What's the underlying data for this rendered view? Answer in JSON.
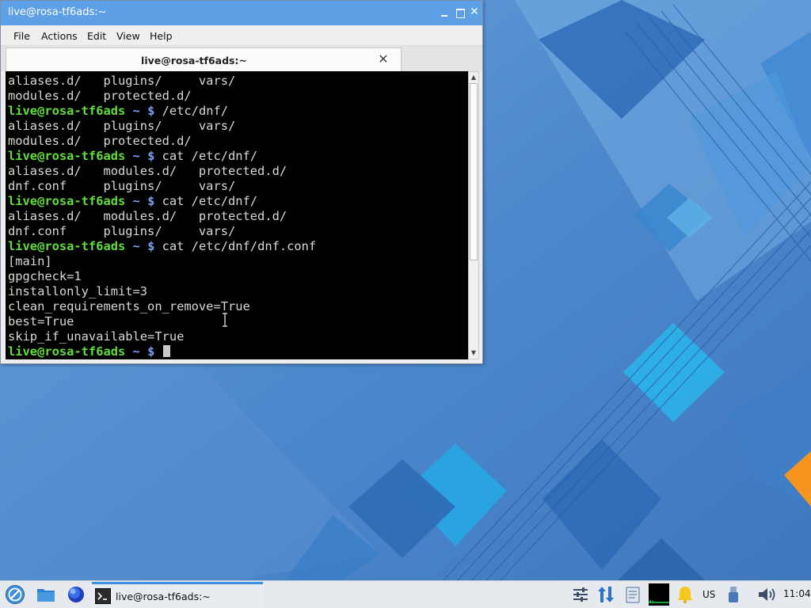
{
  "window": {
    "title": "live@rosa-tf6ads:~",
    "controls": {
      "minimize": "minimize",
      "maximize": "maximize",
      "close": "✕"
    }
  },
  "menubar": {
    "items": [
      "File",
      "Actions",
      "Edit",
      "View",
      "Help"
    ]
  },
  "tab": {
    "label": "live@rosa-tf6ads:~",
    "close": "✕"
  },
  "terminal": {
    "prompt_user": "live@rosa-tf6ads",
    "prompt_symbol": " ~ $ ",
    "lines": [
      {
        "type": "out",
        "text": "aliases.d/   plugins/     vars/"
      },
      {
        "type": "out",
        "text": "modules.d/   protected.d/"
      },
      {
        "type": "prompt",
        "cmd": "/etc/dnf/"
      },
      {
        "type": "out",
        "text": "aliases.d/   plugins/     vars/"
      },
      {
        "type": "out",
        "text": "modules.d/   protected.d/"
      },
      {
        "type": "prompt",
        "cmd": "cat /etc/dnf/"
      },
      {
        "type": "out",
        "text": "aliases.d/   modules.d/   protected.d/"
      },
      {
        "type": "out",
        "text": "dnf.conf     plugins/     vars/"
      },
      {
        "type": "prompt",
        "cmd": "cat /etc/dnf/"
      },
      {
        "type": "out",
        "text": "aliases.d/   modules.d/   protected.d/"
      },
      {
        "type": "out",
        "text": "dnf.conf     plugins/     vars/"
      },
      {
        "type": "prompt",
        "cmd": "cat /etc/dnf/dnf.conf"
      },
      {
        "type": "out",
        "text": "[main]"
      },
      {
        "type": "out",
        "text": "gpgcheck=1"
      },
      {
        "type": "out",
        "text": "installonly_limit=3"
      },
      {
        "type": "out",
        "text": "clean_requirements_on_remove=True"
      },
      {
        "type": "out",
        "text": "best=True"
      },
      {
        "type": "out",
        "text": "skip_if_unavailable=True"
      },
      {
        "type": "prompt",
        "cmd": "",
        "cursor": true
      }
    ]
  },
  "taskbar": {
    "task_label": "live@rosa-tf6ads:~",
    "keyboard_layout": "US",
    "clock": "11:04",
    "icons": [
      "rosa-menu-icon",
      "file-manager-icon",
      "browser-icon",
      "terminal-icon",
      "mixer-icon",
      "network-icon",
      "clipboard-icon",
      "system-monitor-icon",
      "notifications-icon",
      "usb-icon",
      "volume-icon"
    ]
  },
  "colors": {
    "titlebar": "#5da0e5",
    "prompt_user": "#63dc3c",
    "prompt_symbol": "#7aa2f0",
    "terminal_bg": "#000000",
    "task_accent": "#3d8fe0"
  }
}
